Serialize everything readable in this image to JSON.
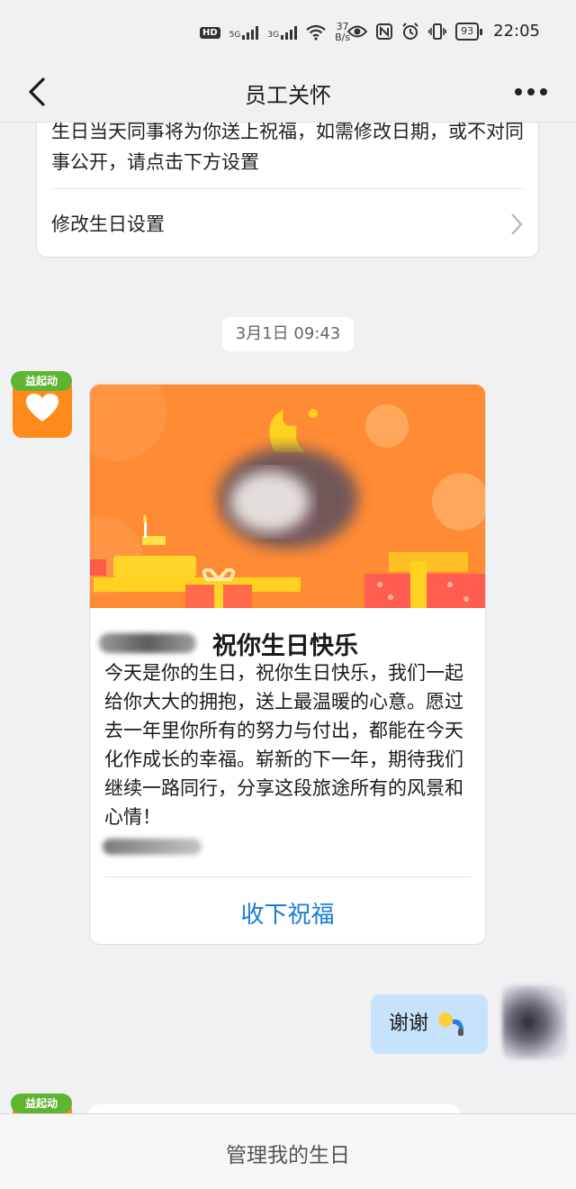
{
  "status_bar": {
    "hd": "HD",
    "sim1": "5G",
    "sim2": "3G",
    "net_speed_value": "37",
    "net_speed_unit": "B/s",
    "battery": "93",
    "time": "22:05"
  },
  "header": {
    "title": "员工关怀"
  },
  "top_card": {
    "description": "生日当天同事将为你送上祝福，如需修改日期，或不对同事公开，请点击下方设置",
    "link_label": "修改生日设置"
  },
  "chat": {
    "timestamp": "3月1日 09:43",
    "bot_tag": "益起动",
    "card": {
      "title": "祝你生日快乐",
      "body": "今天是你的生日，祝你生日快乐，我们一起给你大大的拥抱，送上最温暖的心意。愿过去一年里你所有的努力与付出，都能在今天化作成长的幸福。崭新的下一年，期待我们继续一路同行，分享这段旅途所有的风景和心情！",
      "action": "收下祝福"
    },
    "my_message": "谢谢",
    "second_bot_tag": "益起动"
  },
  "bottom_bar": {
    "button": "管理我的生日"
  },
  "colors": {
    "accent_blue": "#1a7cd9",
    "banner_orange": "#ff8b34",
    "my_bubble": "#c6e3fb",
    "bot_tag_green": "#5fb432"
  }
}
